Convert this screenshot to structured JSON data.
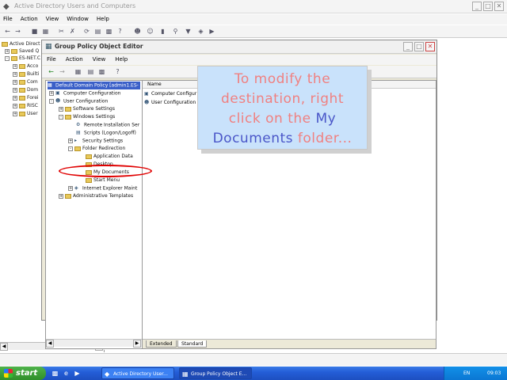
{
  "bg_window": {
    "title": "Active Directory Users and Computers",
    "menu": [
      "File",
      "Action",
      "View",
      "Window",
      "Help"
    ],
    "tree": [
      "Active Direct",
      "Saved Q",
      "ES-NET.C",
      "Acco",
      "Builti",
      "Com",
      "Dom",
      "Forei",
      "RISC",
      "User"
    ]
  },
  "gpo_window": {
    "title": "Group Policy Object Editor",
    "menu": [
      "File",
      "Action",
      "View",
      "Help"
    ],
    "tree": {
      "root": "Default Domain Policy [admin1.ES-",
      "computer_config": "Computer Configuration",
      "user_config": "User Configuration",
      "software_settings": "Software Settings",
      "windows_settings": "Windows Settings",
      "remote_install": "Remote Installation Ser",
      "scripts": "Scripts (Logon/Logoff)",
      "security_settings": "Security Settings",
      "folder_redirection": "Folder Redirection",
      "application_data": "Application Data",
      "desktop": "Desktop",
      "my_documents": "My Documents",
      "start_menu": "Start Menu",
      "ie_maint": "Internet Explorer Maint",
      "admin_templates": "Administrative Templates"
    },
    "right_pane": {
      "column_name": "Name",
      "items": [
        "Computer Configur",
        "User Configuration"
      ]
    },
    "tabs": [
      "Extended",
      "Standard"
    ]
  },
  "callout": {
    "line1": "To modify the",
    "line2": "destination, right",
    "line3a": "click on the ",
    "line3b": "My",
    "line4a": "Documents",
    "line4b": " folder..."
  },
  "taskbar": {
    "start_label": "start",
    "tasks": [
      "Active Directory User...",
      "Group Policy Object E..."
    ],
    "lang": "EN",
    "clock": "09:03"
  },
  "colors": {
    "callout_bg": "#c9e2fb",
    "callout_text": "#f08080",
    "callout_highlight": "#4a56c8",
    "highlight_ring": "#e00000",
    "selection": "#3a5fc8"
  }
}
